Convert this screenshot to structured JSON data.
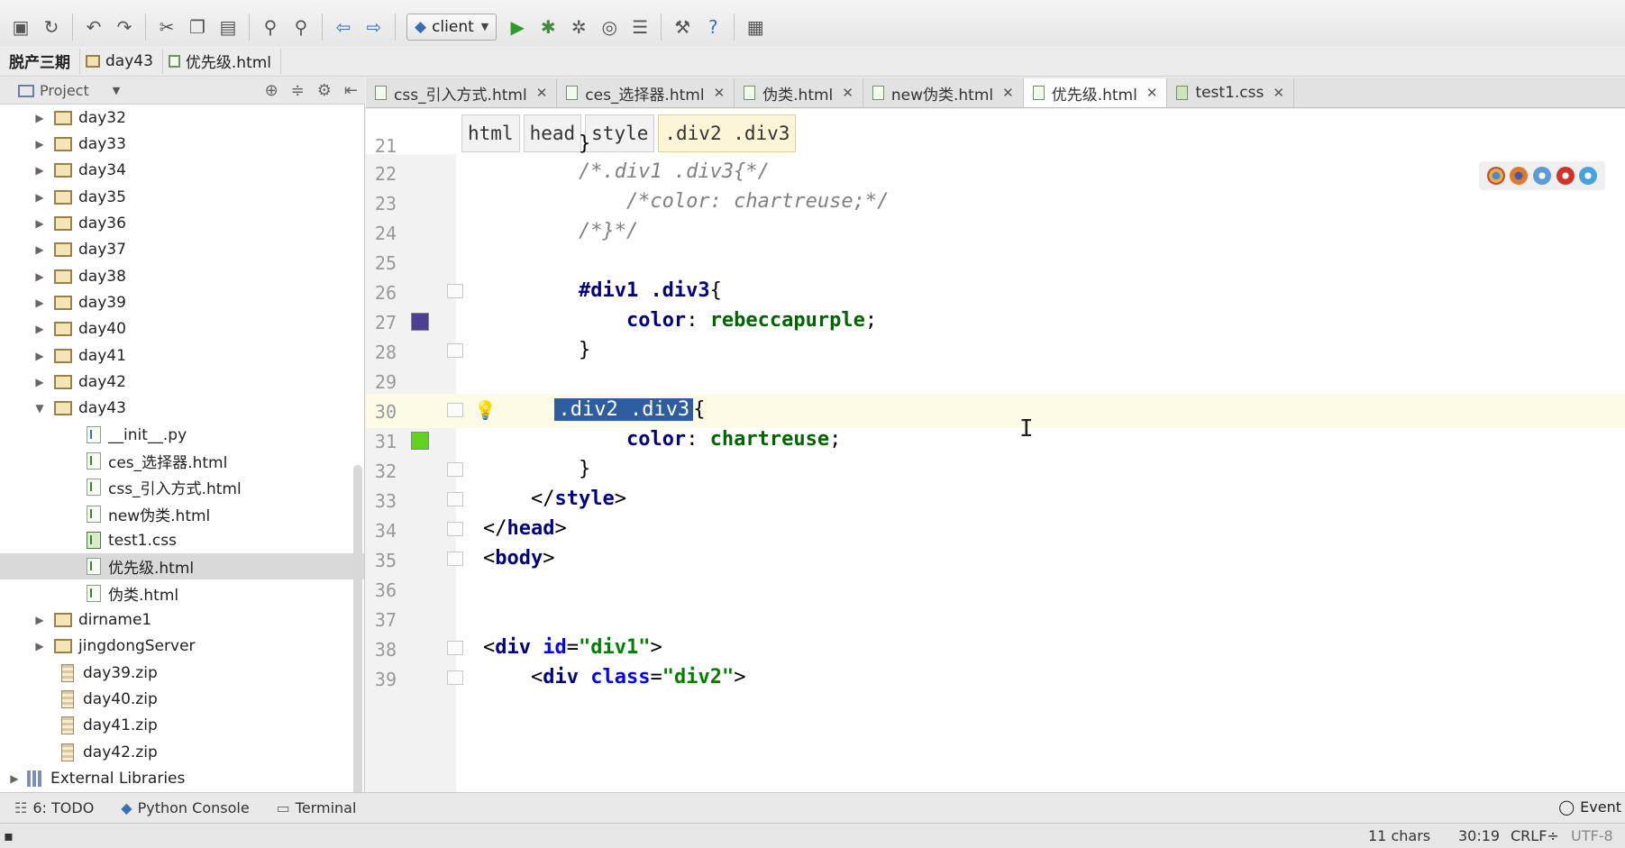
{
  "toolbar": {
    "run_config": "client",
    "icons": [
      "save-icon",
      "sync-icon",
      "undo-icon",
      "redo-icon",
      "cut-icon",
      "copy-icon",
      "paste-icon",
      "find-icon",
      "replace-icon",
      "back-icon",
      "forward-icon",
      "run-icon",
      "debug-icon",
      "coverage-icon",
      "profile-icon",
      "tasks-icon",
      "settings-icon",
      "help-icon",
      "vcs-icon"
    ]
  },
  "breadcrumb": [
    "脱产三期",
    "day43",
    "优先级.html"
  ],
  "project_panel": {
    "title": "Project",
    "items": [
      {
        "label": "day32",
        "type": "folder",
        "expanded": false
      },
      {
        "label": "day33",
        "type": "folder",
        "expanded": false
      },
      {
        "label": "day34",
        "type": "folder",
        "expanded": false
      },
      {
        "label": "day35",
        "type": "folder",
        "expanded": false
      },
      {
        "label": "day36",
        "type": "folder",
        "expanded": false
      },
      {
        "label": "day37",
        "type": "folder",
        "expanded": false
      },
      {
        "label": "day38",
        "type": "folder",
        "expanded": false
      },
      {
        "label": "day39",
        "type": "folder",
        "expanded": false
      },
      {
        "label": "day40",
        "type": "folder",
        "expanded": false
      },
      {
        "label": "day41",
        "type": "folder",
        "expanded": false
      },
      {
        "label": "day42",
        "type": "folder",
        "expanded": false
      },
      {
        "label": "day43",
        "type": "folder",
        "expanded": true
      },
      {
        "label": "__init__.py",
        "type": "py"
      },
      {
        "label": "ces_选择器.html",
        "type": "html"
      },
      {
        "label": "css_引入方式.html",
        "type": "html"
      },
      {
        "label": "new伪类.html",
        "type": "html"
      },
      {
        "label": "test1.css",
        "type": "css"
      },
      {
        "label": "优先级.html",
        "type": "html",
        "selected": true
      },
      {
        "label": "伪类.html",
        "type": "html"
      },
      {
        "label": "dirname1",
        "type": "folder",
        "expanded": false
      },
      {
        "label": "jingdongServer",
        "type": "folder",
        "expanded": false
      },
      {
        "label": "day39.zip",
        "type": "zip"
      },
      {
        "label": "day40.zip",
        "type": "zip"
      },
      {
        "label": "day41.zip",
        "type": "zip"
      },
      {
        "label": "day42.zip",
        "type": "zip"
      },
      {
        "label": "External Libraries",
        "type": "libs",
        "expanded": false
      }
    ]
  },
  "tabs": [
    {
      "label": "css_引入方式.html",
      "type": "html"
    },
    {
      "label": "ces_选择器.html",
      "type": "html"
    },
    {
      "label": "伪类.html",
      "type": "html"
    },
    {
      "label": "new伪类.html",
      "type": "html"
    },
    {
      "label": "优先级.html",
      "type": "html",
      "active": true
    },
    {
      "label": "test1.css",
      "type": "css"
    }
  ],
  "tag_breadcrumb": [
    "html",
    "head",
    "style",
    ".div2 .div3"
  ],
  "editor": {
    "colors": {
      "rebeccapurple": "#663399",
      "chartreuse": "#7fff00"
    },
    "lines": [
      {
        "n": "21",
        "text": "        }"
      },
      {
        "n": "22",
        "text": "        /*.div1 .div3{*/"
      },
      {
        "n": "23",
        "text": "            /*color: chartreuse;*/"
      },
      {
        "n": "24",
        "text": "        /*}*/"
      },
      {
        "n": "25",
        "text": ""
      },
      {
        "n": "26",
        "sel": "#div1 .div3",
        "brace": "{"
      },
      {
        "n": "27",
        "prop": "color",
        "val": "rebeccapurple"
      },
      {
        "n": "28",
        "text": "        }"
      },
      {
        "n": "29",
        "text": ""
      },
      {
        "n": "30",
        "sel": ".div2 .div3",
        "brace": "{"
      },
      {
        "n": "31",
        "prop": "color",
        "val": "chartreuse"
      },
      {
        "n": "32",
        "text": "        }"
      },
      {
        "n": "33",
        "close_tag": "style"
      },
      {
        "n": "34",
        "close_tag": "head"
      },
      {
        "n": "35",
        "open_tag": "body"
      },
      {
        "n": "36",
        "text": ""
      },
      {
        "n": "37",
        "text": ""
      },
      {
        "n": "38",
        "div_id": "div1"
      },
      {
        "n": "39",
        "div_class": "div2"
      }
    ]
  },
  "bottom_tabs": [
    "6: TODO",
    "Python Console",
    "Terminal"
  ],
  "event_log": "Event",
  "status": {
    "chars": "11 chars",
    "position": "30:19",
    "line_sep": "CRLF÷",
    "encoding": "UTF-8"
  }
}
